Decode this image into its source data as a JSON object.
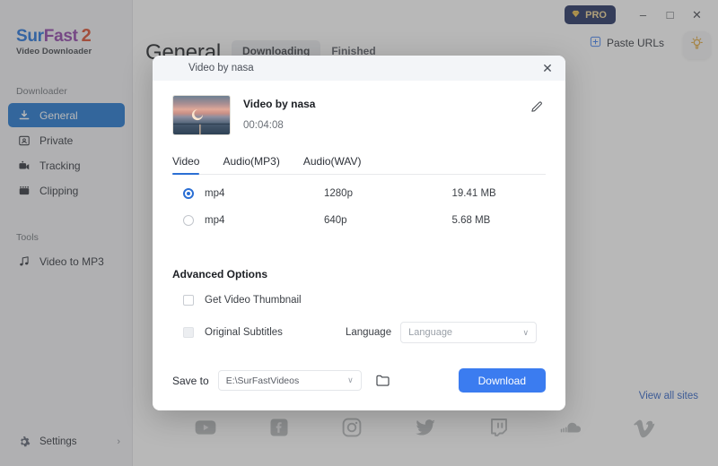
{
  "app": {
    "logo": {
      "part1": "Sur",
      "part2": "Fast",
      "version": "2",
      "subtitle": "Video Downloader"
    }
  },
  "titlebar": {
    "pro_label": "PRO",
    "minimize": "–",
    "maximize": "□",
    "close": "✕"
  },
  "sidebar": {
    "group1_label": "Downloader",
    "items": [
      {
        "label": "General",
        "icon": "download-icon",
        "active": true
      },
      {
        "label": "Private",
        "icon": "private-icon",
        "active": false
      },
      {
        "label": "Tracking",
        "icon": "tracking-icon",
        "active": false
      },
      {
        "label": "Clipping",
        "icon": "clipping-icon",
        "active": false
      }
    ],
    "group2_label": "Tools",
    "tools": [
      {
        "label": "Video to MP3",
        "icon": "music-note-icon"
      }
    ],
    "settings_label": "Settings",
    "settings_chevron": "›"
  },
  "header": {
    "page_title": "General",
    "tabs": [
      {
        "label": "Downloading",
        "active": true
      },
      {
        "label": "Finished",
        "active": false
      }
    ],
    "paste_urls_label": "Paste URLs"
  },
  "main": {
    "view_all_sites": "View all sites",
    "site_icons": [
      "youtube-icon",
      "facebook-icon",
      "instagram-icon",
      "twitter-icon",
      "twitch-icon",
      "soundcloud-icon",
      "vimeo-icon"
    ]
  },
  "modal": {
    "header_title": "Video by nasa",
    "close_glyph": "✕",
    "video": {
      "name": "Video by nasa",
      "duration": "00:04:08"
    },
    "format_tabs": [
      {
        "label": "Video",
        "active": true
      },
      {
        "label": "Audio(MP3)",
        "active": false
      },
      {
        "label": "Audio(WAV)",
        "active": false
      }
    ],
    "formats": [
      {
        "ext": "mp4",
        "resolution": "1280p",
        "size": "19.41 MB",
        "selected": true
      },
      {
        "ext": "mp4",
        "resolution": "640p",
        "size": "5.68 MB",
        "selected": false
      }
    ],
    "advanced": {
      "title": "Advanced Options",
      "options": [
        {
          "label": "Get Video Thumbnail",
          "checked": false,
          "disabled": false
        },
        {
          "label": "Original Subtitles",
          "checked": false,
          "disabled": true
        }
      ],
      "language_label": "Language",
      "language_value": "Language",
      "language_chevron": "∨"
    },
    "save": {
      "label": "Save to",
      "path": "E:\\SurFastVideos",
      "chevron": "∨",
      "download_label": "Download"
    }
  },
  "colors": {
    "accent_blue": "#1a73cf",
    "download_blue": "#3b7cf0",
    "pro_navy": "#1d2b5e",
    "pro_gold": "#f0d694",
    "link_blue": "#2b5fc4"
  }
}
